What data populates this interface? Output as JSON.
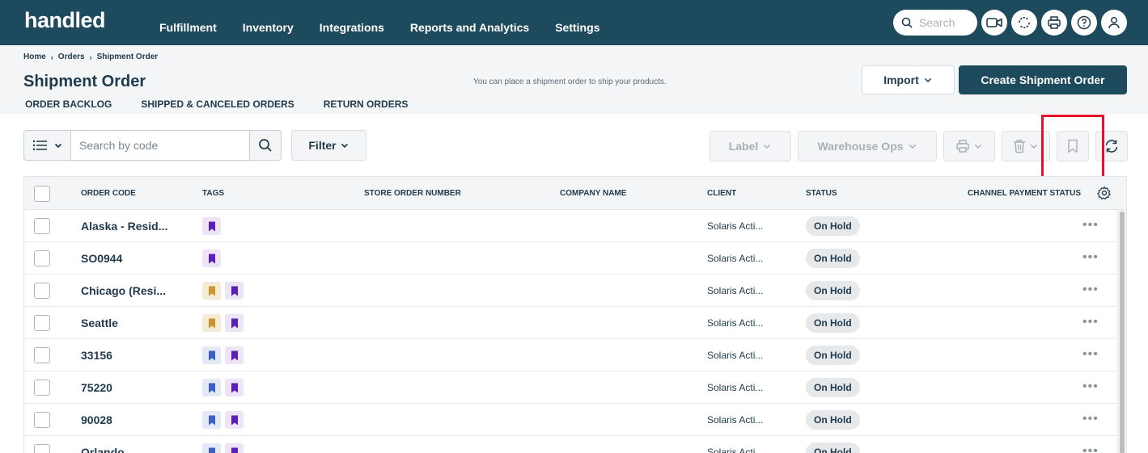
{
  "app": {
    "logo": "handled",
    "nav": [
      "Fulfillment",
      "Inventory",
      "Integrations",
      "Reports and Analytics",
      "Settings"
    ],
    "search_placeholder": "Search"
  },
  "breadcrumb": [
    "Home",
    "Orders",
    "Shipment Order"
  ],
  "page": {
    "title": "Shipment Order",
    "subtitle": "You can place a shipment order to ship your products.",
    "import_label": "Import",
    "create_label": "Create Shipment Order"
  },
  "tabs": [
    "ORDER BACKLOG",
    "SHIPPED & CANCELED ORDERS",
    "RETURN ORDERS"
  ],
  "toolbar": {
    "search_placeholder": "Search by code",
    "filter_label": "Filter",
    "label_btn": "Label",
    "warehouse_btn": "Warehouse Ops"
  },
  "table": {
    "headers": [
      "ORDER CODE",
      "TAGS",
      "STORE ORDER NUMBER",
      "COMPANY NAME",
      "CLIENT",
      "STATUS",
      "CHANNEL PAYMENT STATUS"
    ],
    "rows": [
      {
        "code": "Alaska - Resid...",
        "tags": [
          "purple"
        ],
        "client": "Solaris Acti...",
        "status": "On Hold"
      },
      {
        "code": "SO0944",
        "tags": [
          "purple"
        ],
        "client": "Solaris Acti...",
        "status": "On Hold"
      },
      {
        "code": "Chicago (Resi...",
        "tags": [
          "gold",
          "purple"
        ],
        "client": "Solaris Acti...",
        "status": "On Hold"
      },
      {
        "code": "Seattle",
        "tags": [
          "gold",
          "purple"
        ],
        "client": "Solaris Acti...",
        "status": "On Hold"
      },
      {
        "code": "33156",
        "tags": [
          "blue",
          "purple"
        ],
        "client": "Solaris Acti...",
        "status": "On Hold"
      },
      {
        "code": "75220",
        "tags": [
          "blue",
          "purple"
        ],
        "client": "Solaris Acti...",
        "status": "On Hold"
      },
      {
        "code": "90028",
        "tags": [
          "blue",
          "purple"
        ],
        "client": "Solaris Acti...",
        "status": "On Hold"
      },
      {
        "code": "Orlando",
        "tags": [
          "blue",
          "purple"
        ],
        "client": "Solaris Acti...",
        "status": "On Hold"
      }
    ]
  },
  "colors": {
    "header_bg": "#1d4a5c",
    "tag_purple": "#5b21b6",
    "tag_purple_bg": "#ede4f7",
    "tag_gold": "#c8962f",
    "tag_gold_bg": "#f5ead4",
    "tag_blue": "#3b5fc4",
    "tag_blue_bg": "#e3e9f7",
    "highlight": "#e8112d"
  }
}
